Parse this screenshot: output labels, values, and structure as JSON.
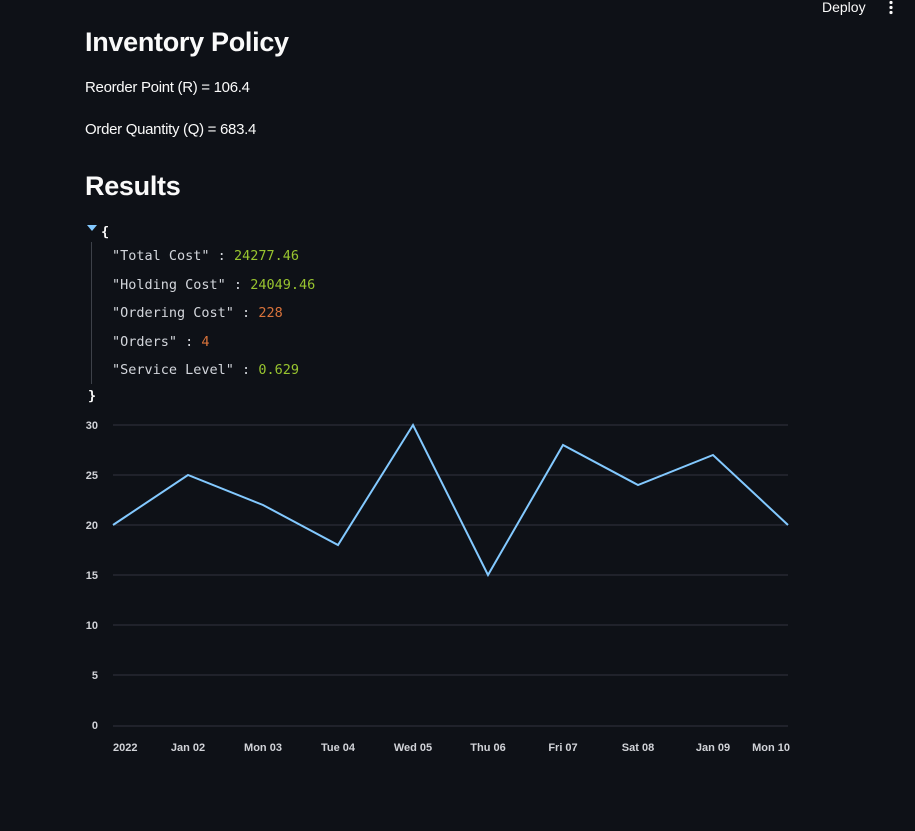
{
  "header": {
    "deploy_label": "Deploy",
    "menu_icon": "kebab-vertical-icon"
  },
  "policy": {
    "title": "Inventory Policy",
    "reorder_point": "Reorder Point (R) = 106.4",
    "order_quantity": "Order Quantity (Q) = 683.4"
  },
  "results": {
    "title": "Results",
    "json": {
      "open_brace": "{",
      "close_brace": "}",
      "entries": [
        {
          "key": "\"Total Cost\"",
          "value": "24277.46",
          "type": "float"
        },
        {
          "key": "\"Holding Cost\"",
          "value": "24049.46",
          "type": "float"
        },
        {
          "key": "\"Ordering Cost\"",
          "value": "228",
          "type": "int"
        },
        {
          "key": "\"Orders\"",
          "value": "4",
          "type": "int"
        },
        {
          "key": "\"Service Level\"",
          "value": "0.629",
          "type": "float"
        }
      ]
    }
  },
  "colors": {
    "background": "#0e1117",
    "line": "#83c9ff",
    "grid": "#31333f",
    "float_value": "#98c42f",
    "int_value": "#d9733b"
  },
  "chart_data": {
    "type": "line",
    "x": [
      "2022",
      "Jan 02",
      "Mon 03",
      "Tue 04",
      "Wed 05",
      "Thu 06",
      "Fri 07",
      "Sat 08",
      "Jan 09",
      "Mon 10"
    ],
    "values": [
      20,
      25,
      22,
      18,
      30,
      15,
      28,
      24,
      27,
      20
    ],
    "yticks": [
      0,
      5,
      10,
      15,
      20,
      25,
      30
    ],
    "ylim": [
      0,
      30
    ],
    "grid": true,
    "title": "",
    "xlabel": "",
    "ylabel": ""
  }
}
